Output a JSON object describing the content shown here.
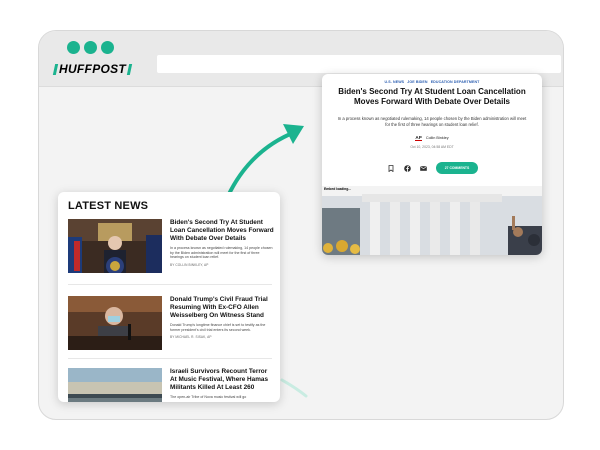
{
  "brand": {
    "logo_text": "HUFFPOST",
    "accent": "#1bb38f"
  },
  "browser": {
    "dots": [
      "dot",
      "dot",
      "dot"
    ]
  },
  "latest_news": {
    "title": "LATEST NEWS",
    "items": [
      {
        "headline": "Biden's Second Try At Student Loan Cancellation Moves Forward With Debate Over Details",
        "desc": "In a process known as negotiated rulemaking, 14 people chosen by the Biden administration will meet for the first of three hearings on student loan relief.",
        "byline": "BY COLLIN BINKLEY, AP"
      },
      {
        "headline": "Donald Trump's Civil Fraud Trial Resuming With Ex-CFO Allen Weisselberg On Witness Stand",
        "desc": "Donald Trump's longtime finance chief is set to testify as the former president's civil trial enters its second week.",
        "byline": "BY MICHAEL R. SISAK, AP"
      },
      {
        "headline": "Israeli Survivors Recount Terror At Music Festival, Where Hamas Militants Killed At Least 260",
        "desc": "The open-air Tribe of Nova music festival will go",
        "byline": ""
      }
    ]
  },
  "article": {
    "crumbs": [
      "U.S. NEWS",
      "JOE BIDEN",
      "EDUCATION DEPARTMENT"
    ],
    "headline": "Biden's Second Try At Student Loan Cancellation Moves Forward With Debate Over Details",
    "sub": "In a process known as negotiated rulemaking, 14 people chosen by the Biden administration will meet for the first of three hearings on student loan relief.",
    "source": "AP",
    "author": "Collin Binkley",
    "date": "Oct 10, 2023, 04:58 AM EDT",
    "comments_label": "27 COMMENTS",
    "image_caption": "Embed loading..."
  }
}
